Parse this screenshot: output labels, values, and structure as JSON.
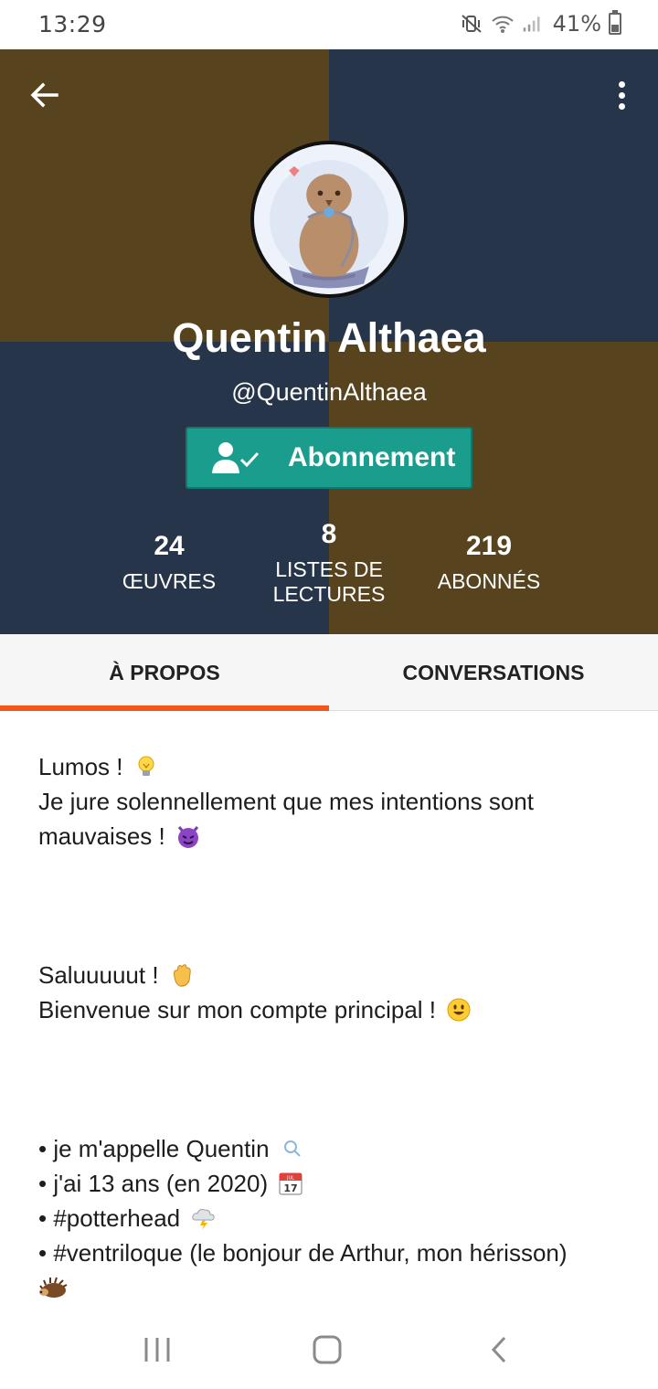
{
  "status_bar": {
    "time": "13:29",
    "battery": "41%",
    "battery_level": 0.41,
    "icons": [
      "mute-vibrate-icon",
      "wifi-icon",
      "signal-icon",
      "battery-icon"
    ]
  },
  "header": {
    "colors": {
      "brown": "#57431d",
      "navy": "#263549"
    },
    "name": "Quentin Althaea",
    "handle": "@QuentinAlthaea",
    "follow_button": {
      "label": "Abonnement",
      "color": "#1a9d8d",
      "icon": "user-check-icon"
    }
  },
  "stats": {
    "works": {
      "value": "24",
      "label": "ŒUVRES"
    },
    "reading_lists": {
      "value": "8",
      "label_line1": "LISTES DE",
      "label_line2": "LECTURES"
    },
    "followers": {
      "value": "219",
      "label": "ABONNÉS"
    }
  },
  "tabs": [
    {
      "label": "À PROPOS",
      "active": true
    },
    {
      "label": "CONVERSATIONS",
      "active": false
    }
  ],
  "tab_indicator_color": "#f4541a",
  "about": {
    "line1": "Lumos !",
    "line2": "Je jure solennellement que mes intentions sont mauvaises !",
    "line3": "Saluuuuut !",
    "line4": "Bienvenue sur mon compte principal !",
    "bullets": [
      "• je m'appelle Quentin",
      "• j'ai 13 ans (en 2020)",
      "• #potterhead",
      "• #ventriloque (le bonjour de Arthur, mon hérisson)"
    ],
    "emojis": [
      "light-bulb-icon",
      "smiling-devil-icon",
      "waving-hand-icon",
      "smiley-face-icon",
      "magnifier-icon",
      "calendar-icon",
      "cloud-lightning-icon",
      "hedgehog-icon"
    ],
    "calendar_emoji": {
      "month": "JUL",
      "day": "17"
    }
  },
  "nav_bar": {
    "buttons": [
      "recent-apps-icon",
      "home-icon",
      "back-icon"
    ]
  }
}
